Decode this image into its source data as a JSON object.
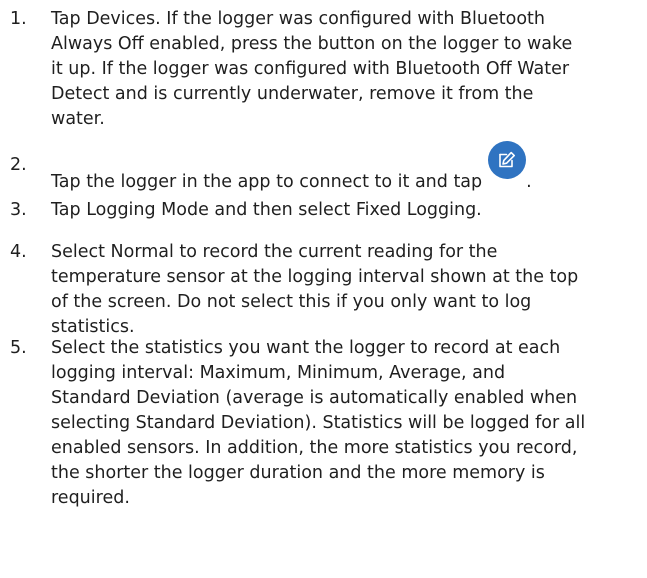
{
  "steps": [
    {
      "number": "1.",
      "lines": [
        "Tap Devices. If the logger was configured with Bluetooth",
        "Always Off enabled, press the button on the logger to wake",
        "it up. If the logger was configured with Bluetooth Off Water",
        "Detect and is currently underwater, remove it from the",
        "water."
      ]
    },
    {
      "number": "2.",
      "before_icon": "Tap the logger in the app to connect to it and tap",
      "icon": "edit-icon",
      "after_icon": "."
    },
    {
      "number": "3.",
      "lines": [
        "Tap Logging Mode and then select Fixed Logging."
      ]
    },
    {
      "number": "4.",
      "lines": [
        "Select Normal to record the current reading for the",
        "temperature sensor at the logging interval shown at the top",
        "of the screen. Do not select this if you only want to log",
        "statistics."
      ]
    },
    {
      "number": "5.",
      "lines": [
        "Select the statistics you want the logger to record at each",
        "logging interval: Maximum, Minimum, Average, and",
        "Standard Deviation (average is automatically enabled when",
        "selecting Standard Deviation). Statistics will be logged for all",
        "enabled sensors. In addition, the more statistics you record,",
        "the shorter the logger duration and the more memory is",
        "required."
      ]
    }
  ],
  "colors": {
    "text": "#1f1f1f",
    "icon_background": "#2f73c1",
    "icon_foreground": "#ffffff"
  }
}
